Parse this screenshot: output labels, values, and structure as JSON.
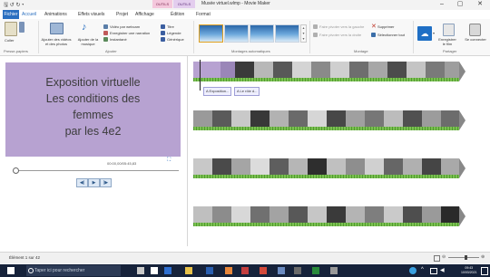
{
  "window": {
    "title": "Musée virtuel.wlmp - Movie Maker",
    "quick_access": "🖫 ↺ ↻ ▾",
    "contextual_tab_video": "OUTILS VIDÉO",
    "contextual_tab_text": "OUTILS TEXTE",
    "minimize": "–",
    "maximize": "▢",
    "close": "✕"
  },
  "tabs": [
    "Fichier",
    "Accueil",
    "Animations",
    "Effets visuels",
    "Projet",
    "Affichage",
    "Édition",
    "Format"
  ],
  "ribbon": {
    "clipboard": {
      "paste_label": "Coller",
      "group_label": "Presse-papiers"
    },
    "add": {
      "add_videos_label": "Ajouter des vidéos et des photos",
      "add_music_label": "Ajouter de la musique",
      "webcam_label": "Vidéo par webcam",
      "narration_label": "Enregistrer une narration",
      "snapshot_label": "Instantané",
      "title_label": "Titre",
      "caption_label": "Légende",
      "credits_label": "Générique",
      "group_label": "Ajouter"
    },
    "themes": {
      "group_label": "Montages automatiques"
    },
    "editing": {
      "rotate_left_label": "Faire pivoter vers la gauche",
      "rotate_right_label": "Faire pivoter vers la droite",
      "remove_label": "Supprimer",
      "select_all_label": "Sélectionner tout",
      "group_label": "Montage"
    },
    "share": {
      "save_movie_label": "Enregistrer le film",
      "signin_label": "Se connecter",
      "group_label": "Partager"
    }
  },
  "preview": {
    "lines": [
      "Exposition virtuelle",
      "Les conditions des",
      "femmes",
      "par les 4e2"
    ],
    "timecode": "00:00,00/05:45,83",
    "prev_frame": "◀|",
    "play": "▶",
    "next_frame": "|▶"
  },
  "timeline": {
    "caption_1": "A Exposition...",
    "caption_2": "A Le rôle d..."
  },
  "status": {
    "text": "Élément 1 sur 42"
  },
  "taskbar": {
    "search_placeholder": "Taper ici pour rechercher",
    "time": "09:43",
    "date": "10/03/2021"
  },
  "colors": {
    "preview_bg": "#b7a2d1",
    "ribbon_accent": "#2a6fc0",
    "taskbar": "#16223a",
    "grass": "#4f9b2f"
  }
}
